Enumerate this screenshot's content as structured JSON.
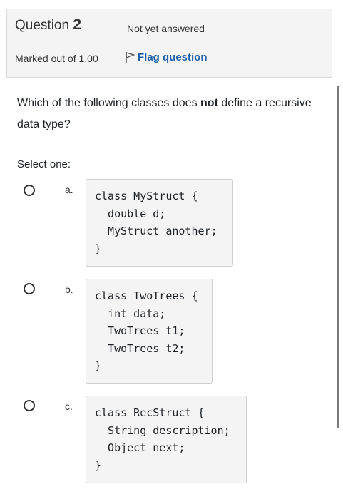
{
  "info": {
    "question_word": "Question",
    "question_number": "2",
    "state": "Not yet answered",
    "grade": "Marked out of 1.00",
    "flag_label": "Flag question",
    "flag_icon": "flag-outline-icon"
  },
  "question": {
    "text_before": "Which of the following classes does ",
    "text_bold": "not",
    "text_after": " define a recursive data type?",
    "prompt": "Select one:"
  },
  "options": [
    {
      "letter": "a.",
      "code": [
        "class MyStruct {",
        "  double d;",
        "  MyStruct another;",
        "}"
      ]
    },
    {
      "letter": "b.",
      "code": [
        "class TwoTrees {",
        "  int data;",
        "  TwoTrees t1;",
        "  TwoTrees t2;",
        "}"
      ]
    },
    {
      "letter": "c.",
      "code": [
        "class RecStruct {",
        "  String description;",
        "  Object next;",
        "}"
      ]
    }
  ]
}
